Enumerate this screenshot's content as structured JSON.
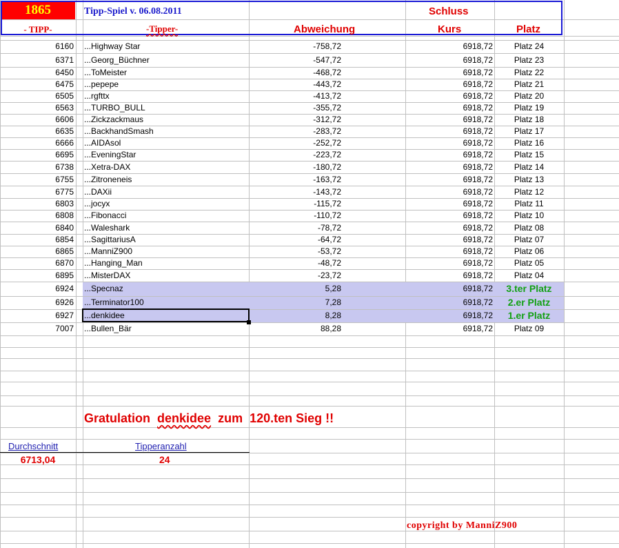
{
  "header": {
    "number": "1865",
    "title": "Tipp-Spiel v. 06.08.2011",
    "schluss": "Schluss",
    "col_tipp": "- TIPP-",
    "col_tipper": "-Tipper-",
    "col_abweichung": "Abweichung",
    "col_kurs": "Kurs",
    "col_platz": "Platz"
  },
  "rows": [
    {
      "tipp": "6160",
      "name": "...Highway Star",
      "abw": "-758,72",
      "kurs": "6918,72",
      "platz": "Platz 24"
    },
    {
      "tipp": "6371",
      "name": "...Georg_Büchner",
      "abw": "-547,72",
      "kurs": "6918,72",
      "platz": "Platz 23"
    },
    {
      "tipp": "6450",
      "name": "...ToMeister",
      "abw": "-468,72",
      "kurs": "6918,72",
      "platz": "Platz 22"
    },
    {
      "tipp": "6475",
      "name": "...pepepe",
      "abw": "-443,72",
      "kurs": "6918,72",
      "platz": "Platz 21"
    },
    {
      "tipp": "6505",
      "name": "...rgfttx",
      "abw": "-413,72",
      "kurs": "6918,72",
      "platz": "Platz 20"
    },
    {
      "tipp": "6563",
      "name": "...TURBO_BULL",
      "abw": "-355,72",
      "kurs": "6918,72",
      "platz": "Platz 19"
    },
    {
      "tipp": "6606",
      "name": "...Zickzackmaus",
      "abw": "-312,72",
      "kurs": "6918,72",
      "platz": "Platz 18"
    },
    {
      "tipp": "6635",
      "name": "...BackhandSmash",
      "abw": "-283,72",
      "kurs": "6918,72",
      "platz": "Platz 17"
    },
    {
      "tipp": "6666",
      "name": "...AIDAsol",
      "abw": "-252,72",
      "kurs": "6918,72",
      "platz": "Platz 16"
    },
    {
      "tipp": "6695",
      "name": "...EveningStar",
      "abw": "-223,72",
      "kurs": "6918,72",
      "platz": "Platz 15"
    },
    {
      "tipp": "6738",
      "name": "...Xetra-DAX",
      "abw": "-180,72",
      "kurs": "6918,72",
      "platz": "Platz 14"
    },
    {
      "tipp": "6755",
      "name": "...Zitroneneis",
      "abw": "-163,72",
      "kurs": "6918,72",
      "platz": "Platz 13"
    },
    {
      "tipp": "6775",
      "name": "...DAXii",
      "abw": "-143,72",
      "kurs": "6918,72",
      "platz": "Platz 12"
    },
    {
      "tipp": "6803",
      "name": "...jocyx",
      "abw": "-115,72",
      "kurs": "6918,72",
      "platz": "Platz 11"
    },
    {
      "tipp": "6808",
      "name": "...Fibonacci",
      "abw": "-110,72",
      "kurs": "6918,72",
      "platz": "Platz 10"
    },
    {
      "tipp": "6840",
      "name": "...Waleshark",
      "abw": "-78,72",
      "kurs": "6918,72",
      "platz": "Platz 08"
    },
    {
      "tipp": "6854",
      "name": "...SagittariusA",
      "abw": "-64,72",
      "kurs": "6918,72",
      "platz": "Platz 07"
    },
    {
      "tipp": "6865",
      "name": "...ManniZ900",
      "abw": "-53,72",
      "kurs": "6918,72",
      "platz": "Platz 06"
    },
    {
      "tipp": "6870",
      "name": "...Hanging_Man",
      "abw": "-48,72",
      "kurs": "6918,72",
      "platz": "Platz 05"
    },
    {
      "tipp": "6895",
      "name": "...MisterDAX",
      "abw": "-23,72",
      "kurs": "6918,72",
      "platz": "Platz 04"
    },
    {
      "tipp": "6924",
      "name": "...Specnaz",
      "abw": "5,28",
      "kurs": "6918,72",
      "platz": "3.ter Platz"
    },
    {
      "tipp": "6926",
      "name": "...Terminator100",
      "abw": "7,28",
      "kurs": "6918,72",
      "platz": "2.er Platz"
    },
    {
      "tipp": "6927",
      "name": "...denkidee",
      "abw": "8,28",
      "kurs": "6918,72",
      "platz": "1.er Platz"
    },
    {
      "tipp": "7007",
      "name": "...Bullen_Bär",
      "abw": "88,28",
      "kurs": "6918,72",
      "platz": "Platz 09"
    }
  ],
  "congrats": {
    "prefix": "Gratulation",
    "name": "denkidee",
    "suffix": "zum  120.ten Sieg !!"
  },
  "stats": {
    "avg_label": "Durchschnitt",
    "avg_value": "6713,04",
    "count_label": "Tipperanzahl",
    "count_value": "24"
  },
  "copyright": "copyright by ManniZ900",
  "colors": {
    "highlight_bg": "#c8c8f0",
    "header_red": "#ff0000",
    "number_yellow": "#ffff00",
    "accent_blue": "#1a1ad6",
    "winner_green": "#12a012",
    "text_red": "#e00000"
  }
}
